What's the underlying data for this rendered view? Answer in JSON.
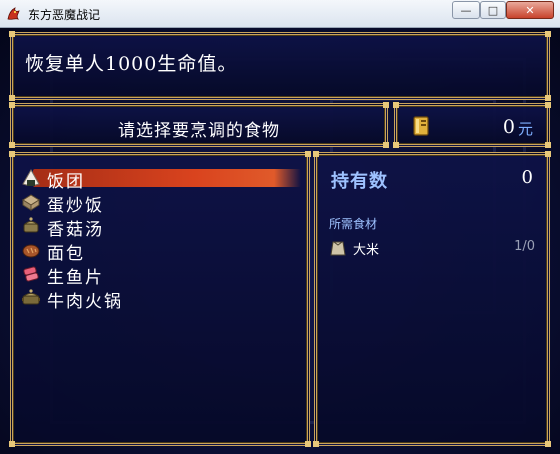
{
  "window": {
    "title": "东方恶魔战记",
    "icon": "app-dragon-icon",
    "controls": {
      "minimize": "—",
      "maximize": "□",
      "close": "✕"
    }
  },
  "help": {
    "text": "恢复单人1000生命值。"
  },
  "prompt": {
    "text": "请选择要烹调的食物"
  },
  "gold": {
    "icon": "gold-book-icon",
    "amount": "0",
    "unit": "元"
  },
  "food_list": {
    "items": [
      {
        "label": "饭团",
        "icon": "rice-ball-icon",
        "selected": true
      },
      {
        "label": "蛋炒饭",
        "icon": "fried-rice-icon",
        "selected": false
      },
      {
        "label": "香菇汤",
        "icon": "soup-pot-icon",
        "selected": false
      },
      {
        "label": "面包",
        "icon": "bread-icon",
        "selected": false
      },
      {
        "label": "生鱼片",
        "icon": "sashimi-icon",
        "selected": false
      },
      {
        "label": "牛肉火锅",
        "icon": "hotpot-icon",
        "selected": false
      }
    ]
  },
  "details": {
    "owned_label": "持有数",
    "owned_count": "0",
    "required_label": "所需食材",
    "ingredients": [
      {
        "name": "大米",
        "icon": "rice-bag-icon",
        "qty": "1/0"
      }
    ]
  },
  "colors": {
    "frame_gold": "#c9a35c",
    "panel_navy": "#0e1246",
    "highlight_red": "#d9431e",
    "label_blue": "#9ec2ff"
  }
}
